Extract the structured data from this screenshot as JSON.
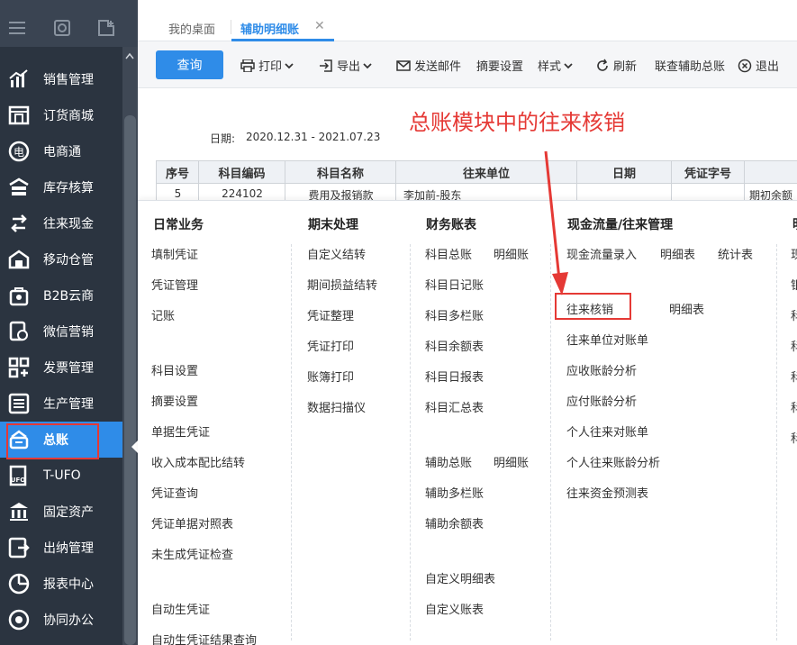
{
  "tabs": [
    {
      "label": "我的桌面"
    },
    {
      "label": "辅助明细账"
    }
  ],
  "tab_close": "✕",
  "toolbar": {
    "query": "查询",
    "print": "打印",
    "export": "导出",
    "send_mail": "发送邮件",
    "summary_settings": "摘要设置",
    "style": "样式",
    "refresh": "刷新",
    "linked_query": "联查辅助总账",
    "exit": "退出"
  },
  "annotation": "总账模块中的往来核销",
  "report": {
    "date_label": "日期:",
    "date_range": "2020.12.31 - 2021.07.23",
    "columns": [
      "序号",
      "科目编码",
      "科目名称",
      "往来单位",
      "日期",
      "凭证字号",
      ""
    ],
    "row": [
      "5",
      "224102",
      "费用及报销款",
      "李加前-股东",
      "",
      "",
      "期初余额"
    ]
  },
  "sidebar": {
    "items": [
      {
        "label": "销售管理",
        "icon": "chart-bars-icon"
      },
      {
        "label": "订货商城",
        "icon": "store-icon"
      },
      {
        "label": "电商通",
        "icon": "ecommerce-icon"
      },
      {
        "label": "库存核算",
        "icon": "warehouse-icon"
      },
      {
        "label": "往来现金",
        "icon": "exchange-icon"
      },
      {
        "label": "移动仓管",
        "icon": "mobile-warehouse-icon"
      },
      {
        "label": "B2B云商",
        "icon": "b2b-bag-icon"
      },
      {
        "label": "微信营销",
        "icon": "wechat-marketing-icon"
      },
      {
        "label": "发票管理",
        "icon": "invoice-grid-icon"
      },
      {
        "label": "生产管理",
        "icon": "production-icon"
      },
      {
        "label": "总账",
        "icon": "ledger-icon"
      },
      {
        "label": "T-UFO",
        "icon": "ufo-icon"
      },
      {
        "label": "固定资产",
        "icon": "bank-icon"
      },
      {
        "label": "出纳管理",
        "icon": "cashier-icon"
      },
      {
        "label": "报表中心",
        "icon": "pie-chart-icon"
      },
      {
        "label": "协同办公",
        "icon": "collaboration-icon"
      }
    ]
  },
  "menu": {
    "daily": {
      "title": "日常业务",
      "items": [
        "填制凭证",
        "凭证管理",
        "记账",
        "科目设置",
        "摘要设置",
        "单据生凭证",
        "收入成本配比结转",
        "凭证查询",
        "凭证单据对照表",
        "未生成凭证检查",
        "自动生凭证",
        "自动生凭证结果查询"
      ]
    },
    "period_end": {
      "title": "期末处理",
      "items": [
        "自定义结转",
        "期间损益结转",
        "凭证整理",
        "凭证打印",
        "账簿打印",
        "数据扫描仪"
      ]
    },
    "finance_books": {
      "title": "财务账表",
      "items": [
        "科目总账",
        "明细账",
        "科目日记账",
        "科目多栏账",
        "科目余额表",
        "科目日报表",
        "科目汇总表",
        "辅助总账",
        "明细账",
        "辅助多栏账",
        "辅助余额表",
        "自定义明细表",
        "自定义账表"
      ]
    },
    "cashflow": {
      "title": "现金流量/往来管理",
      "items": [
        "现金流量录入",
        "明细表",
        "统计表",
        "往来核销",
        "明细表",
        "往来单位对账单",
        "应收账龄分析",
        "应付账龄分析",
        "个人往来对账单",
        "个人往来账龄分析",
        "往来资金预测表"
      ]
    },
    "next_col": {
      "title": "明",
      "items": [
        "现",
        "银",
        "科",
        "科",
        "科",
        "科",
        "科"
      ]
    }
  }
}
